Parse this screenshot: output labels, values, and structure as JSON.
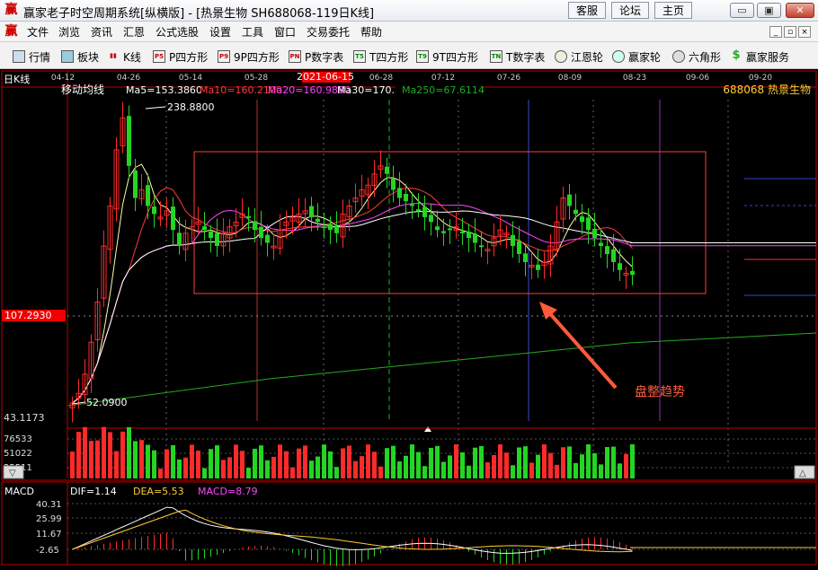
{
  "window": {
    "title": "赢家老子时空周期系统[纵横版] - [热景生物   SH688068-119日K线]",
    "links": [
      "客服",
      "论坛",
      "主页"
    ],
    "controls": {
      "minimize": "▭",
      "restore": "▣",
      "close": "✕"
    }
  },
  "menu": {
    "items": [
      "文件",
      "浏览",
      "资讯",
      "汇恩",
      "公式选股",
      "设置",
      "工具",
      "窗口",
      "交易委托",
      "帮助"
    ],
    "mdi": [
      "_",
      "▫",
      "×"
    ]
  },
  "toolbar": {
    "items": [
      {
        "label": "行情",
        "icon": "grid-icon"
      },
      {
        "label": "板块",
        "icon": "blocks-icon"
      },
      {
        "label": "K线",
        "icon": "candlestick-icon"
      },
      {
        "label": "P四方形",
        "icon": "P5"
      },
      {
        "label": "9P四方形",
        "icon": "P9"
      },
      {
        "label": "P数字表",
        "icon": "PN"
      },
      {
        "label": "T四方形",
        "icon": "T5"
      },
      {
        "label": "9T四方形",
        "icon": "T9"
      },
      {
        "label": "T数字表",
        "icon": "TN"
      },
      {
        "label": "江恩轮",
        "icon": "wheel-icon"
      },
      {
        "label": "赢家轮",
        "icon": "wheel-icon"
      },
      {
        "label": "六角形",
        "icon": "hexagon-icon"
      },
      {
        "label": "赢家服务",
        "icon": "dollar-icon"
      }
    ]
  },
  "chart": {
    "panel_title": "日K线",
    "indicator_name": "移动均线",
    "stock_label": "688068  热景生物",
    "ma_labels": [
      {
        "text": "Ma5=153.3860",
        "color": "#ffffff"
      },
      {
        "text": "Ma10=160.2100",
        "color": "#ff3b3b"
      },
      {
        "text": "Ma20=160.9880",
        "color": "#ff44ff"
      },
      {
        "text": "Ma30=170.3223",
        "color": "#ffffff"
      },
      {
        "text": "Ma250=67.6114",
        "color": "#22aa22"
      }
    ],
    "date_ticks": [
      "04-12",
      "04-26",
      "05-14",
      "05-28",
      "2021-06-15",
      "06-28",
      "07-12",
      "07-26",
      "08-09",
      "08-23",
      "09-06",
      "09-20"
    ],
    "highlight_date": "2021-06-15",
    "price_high_label": "238.8800",
    "price_low_label": "52.0900",
    "axis_max": "43.1173",
    "axis_marker": "107.2930",
    "annotation": "盘整趋势",
    "colors": {
      "up": "#ff2a2a",
      "down": "#22d622",
      "box": "#ff3c3c",
      "annotation": "#ff5a3a"
    }
  },
  "volume": {
    "ticks": [
      "76533",
      "51022",
      "25511"
    ]
  },
  "macd": {
    "title": "MACD",
    "dif": "DIF=1.14",
    "dea": "DEA=5.53",
    "macd": "MACD=8.79",
    "ticks": [
      "40.31",
      "25.99",
      "11.67",
      "-2.65"
    ]
  },
  "chart_data": {
    "type": "candlestick",
    "title": "热景生物 SH688068 日K线",
    "candles_close": [
      52,
      58,
      70,
      90,
      115,
      150,
      175,
      210,
      230,
      200,
      180,
      185,
      175,
      170,
      168,
      172,
      160,
      150,
      158,
      162,
      165,
      160,
      155,
      150,
      158,
      162,
      165,
      170,
      168,
      160,
      155,
      152,
      150,
      160,
      165,
      168,
      170,
      172,
      168,
      165,
      162,
      160,
      158,
      170,
      175,
      180,
      185,
      188,
      195,
      200,
      195,
      185,
      180,
      178,
      175,
      172,
      168,
      165,
      160,
      158,
      160,
      162,
      158,
      155,
      152,
      150,
      148,
      155,
      160,
      158,
      150,
      145,
      140,
      138,
      135,
      140,
      150,
      165,
      180,
      175,
      170,
      165,
      160,
      155,
      150,
      145,
      140,
      135,
      133,
      132
    ],
    "ma_series": [
      "Ma5",
      "Ma10",
      "Ma20",
      "Ma30",
      "Ma250"
    ],
    "annotation": "盘整趋势"
  }
}
